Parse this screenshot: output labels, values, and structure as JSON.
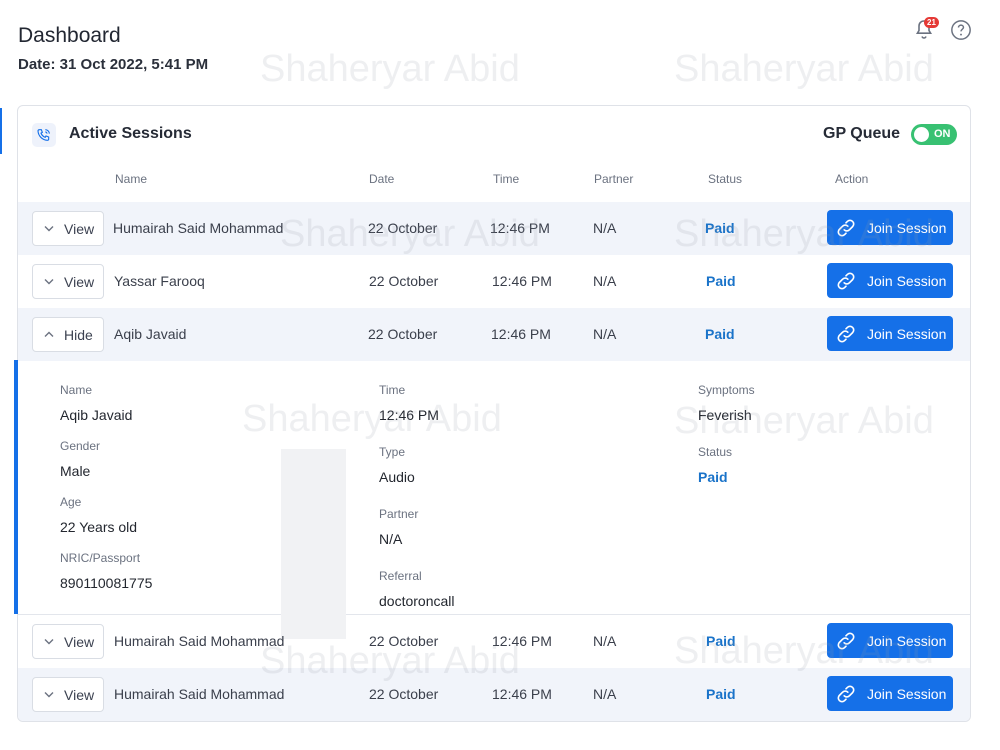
{
  "header": {
    "title": "Dashboard",
    "date": "Date: 31 Oct 2022, 5:41 PM",
    "notification_count": "21"
  },
  "watermark": "Shaheryar Abid",
  "card": {
    "title": "Active Sessions",
    "queue_label": "GP Queue",
    "queue_toggle": "ON"
  },
  "columns": [
    "Name",
    "Date",
    "Time",
    "Partner",
    "Status",
    "Action"
  ],
  "rows": [
    {
      "toggle": "View",
      "name": "Humairah Said Mohammad",
      "date": "22 October",
      "time": "12:46 PM",
      "partner": "N/A",
      "status": "Paid",
      "action": "Join Session"
    },
    {
      "toggle": "View",
      "name": "Yassar Farooq",
      "date": "22 October",
      "time": "12:46 PM",
      "partner": "N/A",
      "status": "Paid",
      "action": "Join Session"
    },
    {
      "toggle": "Hide",
      "name": "Aqib Javaid",
      "date": "22 October",
      "time": "12:46 PM",
      "partner": "N/A",
      "status": "Paid",
      "action": "Join Session"
    },
    {
      "toggle": "View",
      "name": "Humairah Said Mohammad",
      "date": "22 October",
      "time": "12:46 PM",
      "partner": "N/A",
      "status": "Paid",
      "action": "Join Session"
    },
    {
      "toggle": "View",
      "name": "Humairah Said Mohammad",
      "date": "22 October",
      "time": "12:46 PM",
      "partner": "N/A",
      "status": "Paid",
      "action": "Join Session"
    }
  ],
  "details": {
    "name_label": "Name",
    "name": "Aqib Javaid",
    "gender_label": "Gender",
    "gender": "Male",
    "age_label": "Age",
    "age": "22 Years old",
    "nric_label": "NRIC/Passport",
    "nric": "890110081775",
    "time_label": "Time",
    "time": "12:46 PM",
    "type_label": "Type",
    "type": "Audio",
    "partner_label": "Partner",
    "partner": "N/A",
    "referral_label": "Referral",
    "referral": "doctoroncall",
    "symptoms_label": "Symptoms",
    "symptoms": "Feverish",
    "status_label": "Status",
    "status": "Paid"
  },
  "colors": {
    "accent": "#1570e8",
    "status": "#1a73c9",
    "toggle_on": "#38c172",
    "row_alt": "#f1f4fa"
  }
}
